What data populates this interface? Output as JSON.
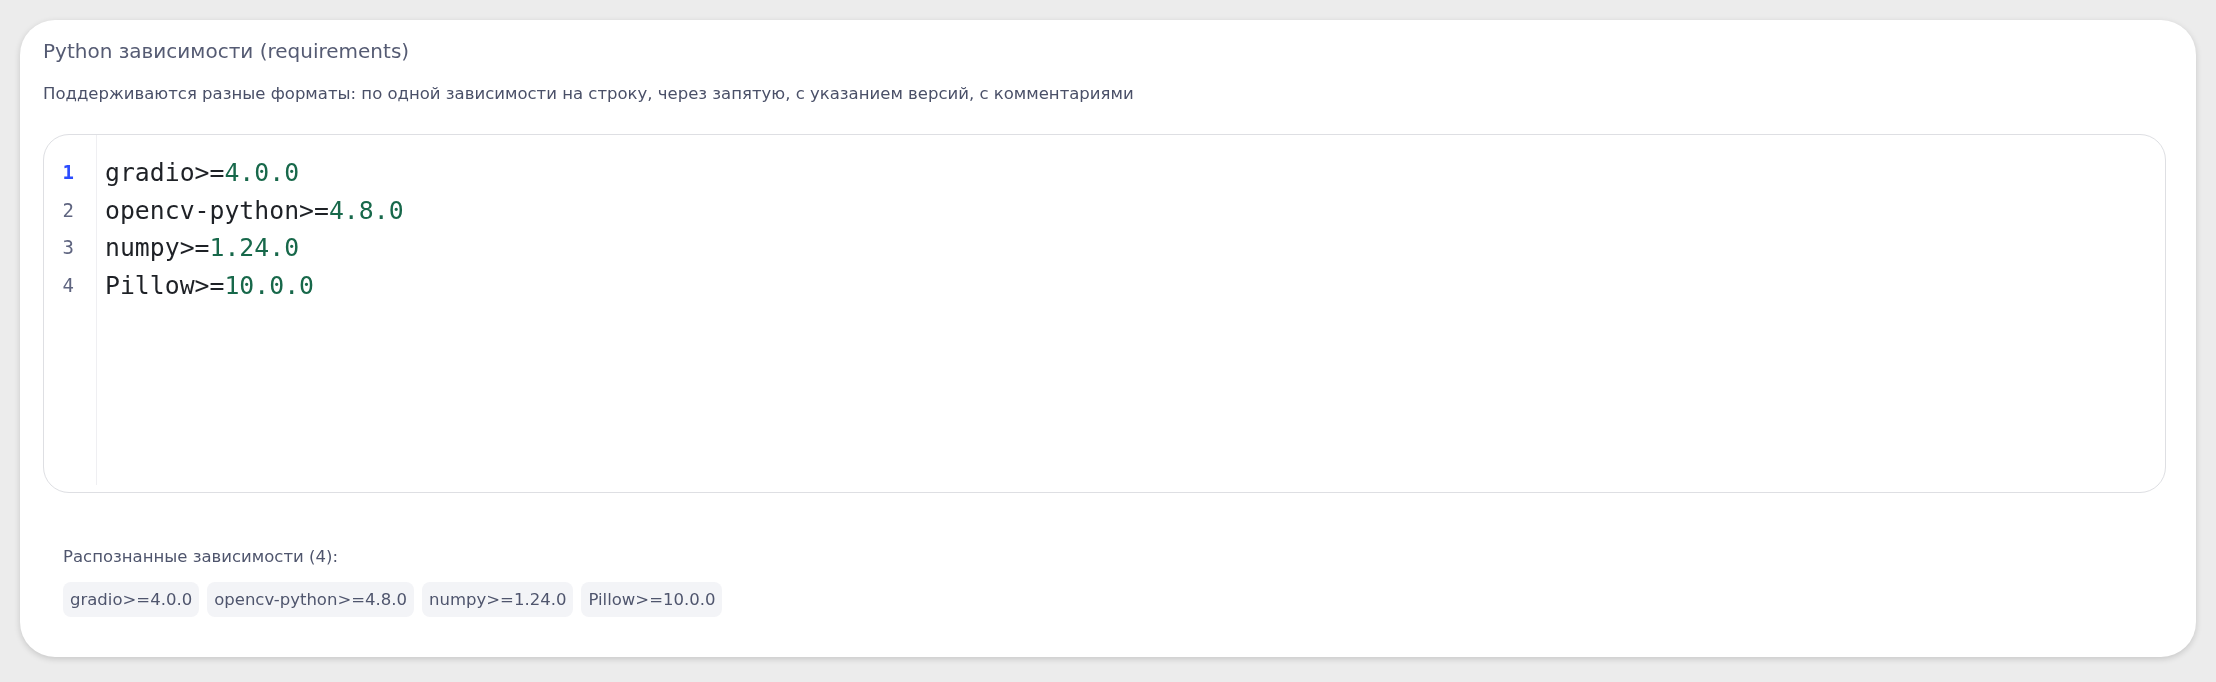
{
  "panel": {
    "title": "Python зависимости (requirements)",
    "description": "Поддерживаются разные форматы: по одной зависимости на строку, через запятую, с указанием версий, с комментариями"
  },
  "editor": {
    "lines": [
      {
        "number": "1",
        "active": true,
        "tokens": [
          {
            "kind": "name",
            "text": "gradio>="
          },
          {
            "kind": "number",
            "text": "4.0.0"
          }
        ]
      },
      {
        "number": "2",
        "active": false,
        "tokens": [
          {
            "kind": "name",
            "text": "opencv-python>="
          },
          {
            "kind": "number",
            "text": "4.8.0"
          }
        ]
      },
      {
        "number": "3",
        "active": false,
        "tokens": [
          {
            "kind": "name",
            "text": "numpy>="
          },
          {
            "kind": "number",
            "text": "1.24.0"
          }
        ]
      },
      {
        "number": "4",
        "active": false,
        "tokens": [
          {
            "kind": "name",
            "text": "Pillow>="
          },
          {
            "kind": "number",
            "text": "10.0.0"
          }
        ]
      }
    ]
  },
  "parsed": {
    "label": "Распознанные зависимости (4):",
    "items": [
      "gradio>=4.0.0",
      "opencv-python>=4.8.0",
      "numpy>=1.24.0",
      "Pillow>=10.0.0"
    ]
  }
}
